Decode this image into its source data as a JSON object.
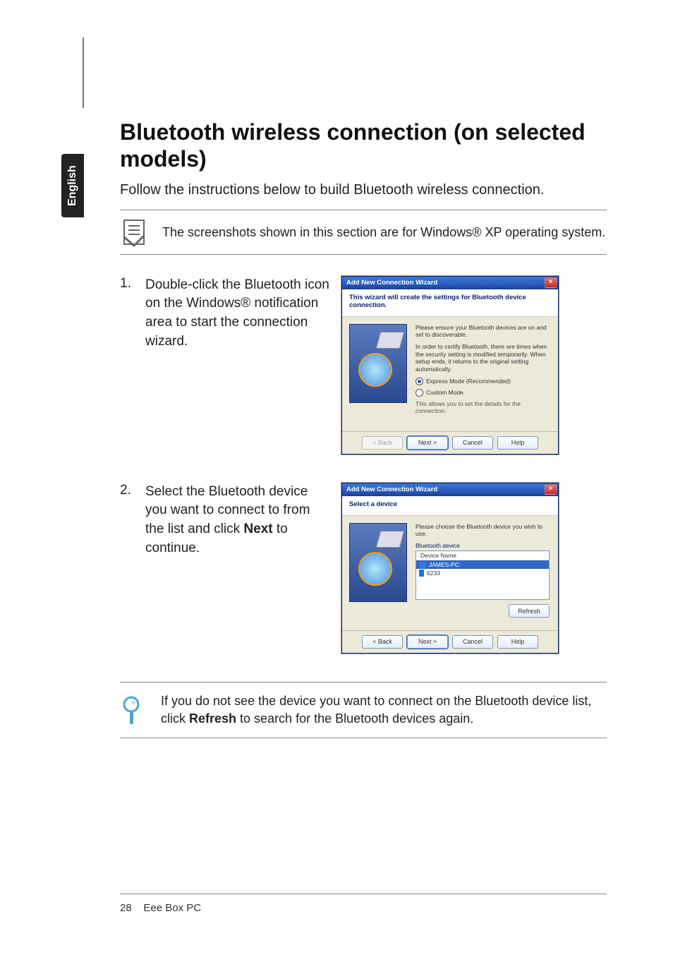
{
  "side_tab": "English",
  "title": "Bluetooth wireless connection (on selected models)",
  "intro": "Follow the instructions below to build Bluetooth wireless connection.",
  "note": "The screenshots shown in this section are for Windows® XP operating system.",
  "steps": [
    {
      "num": "1.",
      "text": "Double-click the Bluetooth icon on the Windows® notification area to start the connection wizard."
    },
    {
      "num": "2.",
      "text_before": "Select the Bluetooth device you want to connect to from the list and click ",
      "bold": "Next",
      "text_after": " to continue."
    }
  ],
  "tip_before": "If you do not see the device you want to connect on the Bluetooth device list, click ",
  "tip_bold": "Refresh",
  "tip_after": " to search for the Bluetooth devices again.",
  "wizard1": {
    "title": "Add New Connection Wizard",
    "header": "This wizard will create the settings for Bluetooth device connection.",
    "para1": "Please ensure your Bluetooth devices are on and set to discoverable.",
    "para2": "In order to certify Bluetooth, there are times when the security setting is modified temporarily. When setup ends, it returns to the original setting automatically.",
    "opt1": "Express Mode (Recommended)",
    "opt2": "Custom Mode",
    "opt2_sub": "This allows you to set the details for the connection.",
    "buttons": {
      "back": "< Back",
      "next": "Next >",
      "cancel": "Cancel",
      "help": "Help"
    }
  },
  "wizard2": {
    "title": "Add New Connection Wizard",
    "header": "Select a device",
    "instr": "Please choose the Bluetooth device you wish to use.",
    "group": "Bluetooth device",
    "col": "Device Name",
    "dev1": "JAMES-PC",
    "dev2": "6233",
    "refresh": "Refresh",
    "buttons": {
      "back": "< Back",
      "next": "Next >",
      "cancel": "Cancel",
      "help": "Help"
    }
  },
  "footer": {
    "page": "28",
    "label": "Eee Box PC"
  }
}
